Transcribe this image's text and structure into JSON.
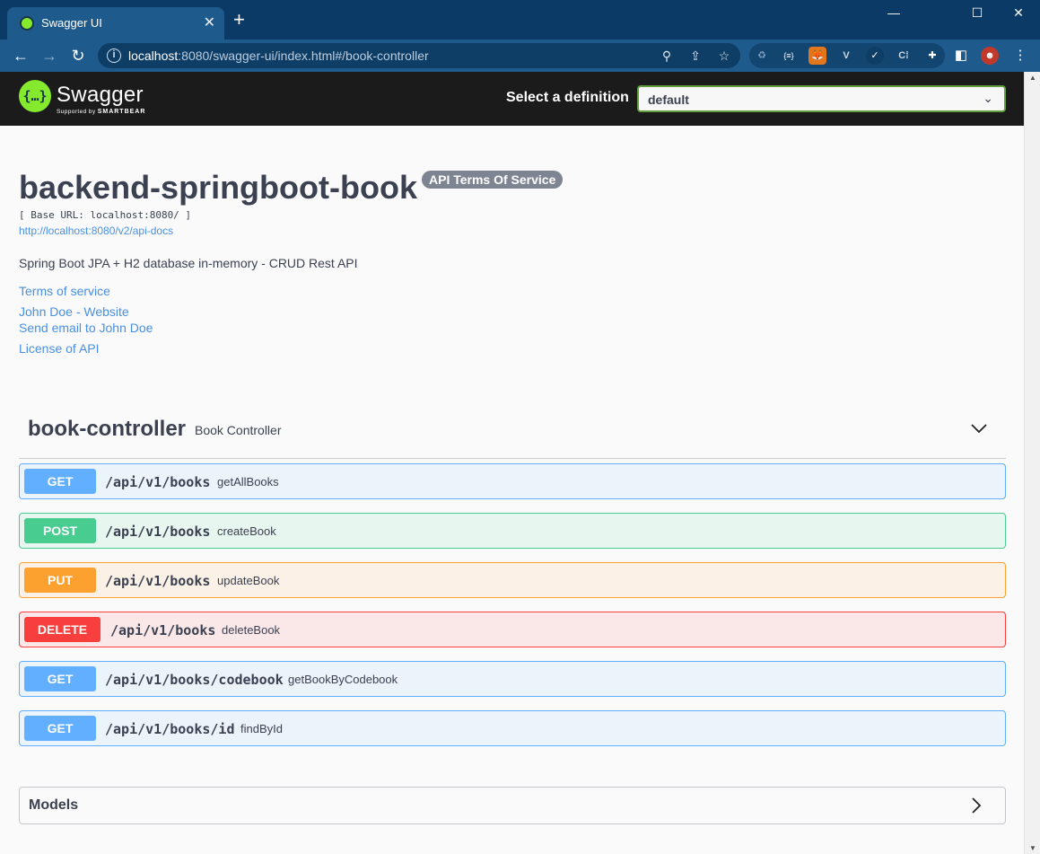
{
  "browser": {
    "tab_title": "Swagger UI",
    "tab_close": "✕",
    "new_tab": "+",
    "url_host": "localhost",
    "url_rest": ":8080/swagger-ui/index.html#/book-controller",
    "window_controls": {
      "minimize": "—",
      "maximize": "☐",
      "close": "✕"
    }
  },
  "topbar": {
    "logo_text": "Swagger",
    "logo_sub_prefix": "Supported by",
    "logo_sub_brand": "SMARTBEAR",
    "definition_label": "Select a definition",
    "definition_value": "default"
  },
  "info": {
    "title": "backend-springboot-book",
    "badge": "API Terms Of Service",
    "base_url": "[ Base URL: localhost:8080/ ]",
    "docs_link": "http://localhost:8080/v2/api-docs",
    "description": "Spring Boot JPA + H2 database in-memory - CRUD Rest API",
    "links": {
      "terms": "Terms of service",
      "website": "John Doe - Website",
      "email": "Send email to John Doe",
      "license": "License of API"
    }
  },
  "tag": {
    "name": "book-controller",
    "description": "Book Controller"
  },
  "operations": [
    {
      "method": "GET",
      "path": "/api/v1/books",
      "summary": "getAllBooks"
    },
    {
      "method": "POST",
      "path": "/api/v1/books",
      "summary": "createBook"
    },
    {
      "method": "PUT",
      "path": "/api/v1/books",
      "summary": "updateBook"
    },
    {
      "method": "DELETE",
      "path": "/api/v1/books",
      "summary": "deleteBook"
    },
    {
      "method": "GET",
      "path": "/api/v1/books/codebook",
      "summary": "getBookByCodebook"
    },
    {
      "method": "GET",
      "path": "/api/v1/books/id",
      "summary": "findById"
    }
  ],
  "models": {
    "label": "Models"
  },
  "colors": {
    "get": "#61affe",
    "post": "#49cc90",
    "put": "#fca130",
    "delete": "#f93e3e",
    "swagger_green": "#85ea2d",
    "link": "#4990e2"
  }
}
